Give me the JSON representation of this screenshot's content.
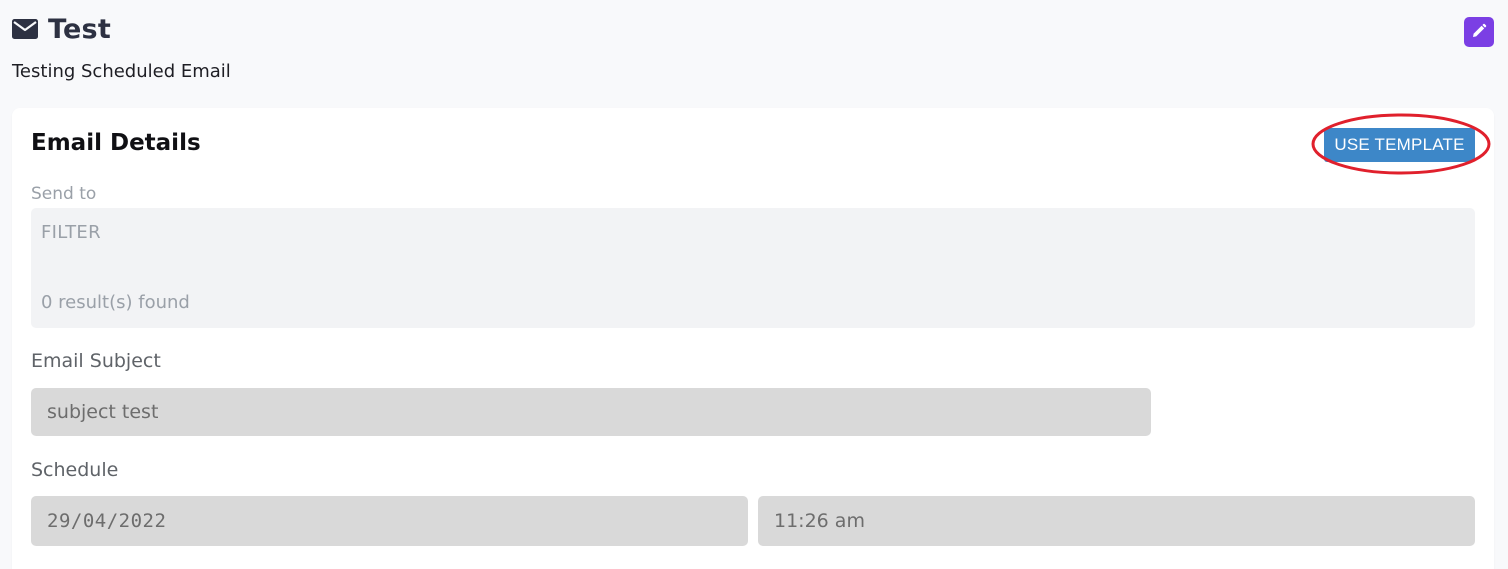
{
  "header": {
    "title": "Test",
    "description": "Testing Scheduled Email",
    "icon": "mail-icon",
    "edit_icon": "pencil-icon"
  },
  "card": {
    "title": "Email Details",
    "template_button": "USE TEMPLATE",
    "send_to": {
      "label": "Send to",
      "filter_label": "FILTER",
      "results": "0 result(s) found"
    },
    "subject": {
      "label": "Email Subject",
      "value": "subject test"
    },
    "schedule": {
      "label": "Schedule",
      "date": "29/04/2022",
      "time": "11:26 am"
    }
  },
  "colors": {
    "accent_purple": "#7b3fe4",
    "template_button_blue": "#3d87c8",
    "highlight_red": "#e0202c"
  }
}
